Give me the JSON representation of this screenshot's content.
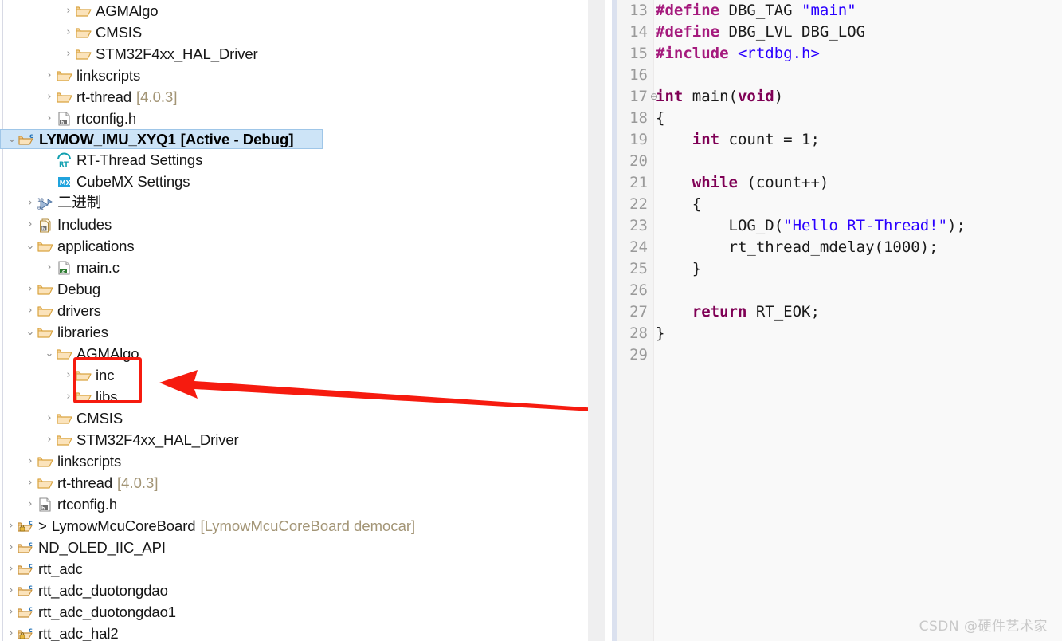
{
  "explorer": {
    "name": "project-explorer",
    "rows": [
      {
        "indent": 3,
        "twisty": "collapsed",
        "icon": "folder-icon",
        "label": "AGMAlgo",
        "suffix": ""
      },
      {
        "indent": 3,
        "twisty": "collapsed",
        "icon": "folder-icon",
        "label": "CMSIS",
        "suffix": ""
      },
      {
        "indent": 3,
        "twisty": "collapsed",
        "icon": "folder-icon",
        "label": "STM32F4xx_HAL_Driver",
        "suffix": ""
      },
      {
        "indent": 2,
        "twisty": "collapsed",
        "icon": "folder-icon",
        "label": "linkscripts",
        "suffix": ""
      },
      {
        "indent": 2,
        "twisty": "collapsed",
        "icon": "folder-icon",
        "label": "rt-thread",
        "suffix": "[4.0.3]"
      },
      {
        "indent": 2,
        "twisty": "collapsed",
        "icon": "header-file-icon",
        "label": "rtconfig.h",
        "suffix": ""
      },
      {
        "indent": 0,
        "twisty": "expanded",
        "icon": "c-project-icon",
        "label": "LYMOW_IMU_XYQ1",
        "suffix": "[Active - Debug]",
        "selected": true
      },
      {
        "indent": 2,
        "twisty": "none",
        "icon": "rt-thread-settings-icon",
        "label": "RT-Thread Settings",
        "suffix": ""
      },
      {
        "indent": 2,
        "twisty": "none",
        "icon": "cubemx-settings-icon",
        "label": "CubeMX Settings",
        "suffix": ""
      },
      {
        "indent": 1,
        "twisty": "collapsed",
        "icon": "binaries-icon",
        "label": "二进制",
        "suffix": "",
        "cjk": true
      },
      {
        "indent": 1,
        "twisty": "collapsed",
        "icon": "includes-icon",
        "label": "Includes",
        "suffix": ""
      },
      {
        "indent": 1,
        "twisty": "expanded",
        "icon": "folder-icon",
        "label": "applications",
        "suffix": ""
      },
      {
        "indent": 2,
        "twisty": "collapsed",
        "icon": "c-file-icon",
        "label": "main.c",
        "suffix": ""
      },
      {
        "indent": 1,
        "twisty": "collapsed",
        "icon": "folder-icon",
        "label": "Debug",
        "suffix": ""
      },
      {
        "indent": 1,
        "twisty": "collapsed",
        "icon": "folder-icon",
        "label": "drivers",
        "suffix": ""
      },
      {
        "indent": 1,
        "twisty": "expanded",
        "icon": "folder-icon",
        "label": "libraries",
        "suffix": ""
      },
      {
        "indent": 2,
        "twisty": "expanded",
        "icon": "folder-icon",
        "label": "AGMAlgo",
        "suffix": ""
      },
      {
        "indent": 3,
        "twisty": "collapsed",
        "icon": "folder-icon",
        "label": "inc",
        "suffix": "",
        "highlighted": true
      },
      {
        "indent": 3,
        "twisty": "collapsed",
        "icon": "folder-icon",
        "label": "libs",
        "suffix": "",
        "highlighted": true
      },
      {
        "indent": 2,
        "twisty": "collapsed",
        "icon": "folder-icon",
        "label": "CMSIS",
        "suffix": ""
      },
      {
        "indent": 2,
        "twisty": "collapsed",
        "icon": "folder-icon",
        "label": "STM32F4xx_HAL_Driver",
        "suffix": ""
      },
      {
        "indent": 1,
        "twisty": "collapsed",
        "icon": "folder-icon",
        "label": "linkscripts",
        "suffix": ""
      },
      {
        "indent": 1,
        "twisty": "collapsed",
        "icon": "folder-icon",
        "label": "rt-thread",
        "suffix": "[4.0.3]"
      },
      {
        "indent": 1,
        "twisty": "collapsed",
        "icon": "header-file-icon",
        "label": "rtconfig.h",
        "suffix": ""
      },
      {
        "indent": 0,
        "twisty": "collapsed",
        "icon": "c-project-locked-icon",
        "prefix": ">",
        "label": "LymowMcuCoreBoard",
        "suffix": "[LymowMcuCoreBoard democar]"
      },
      {
        "indent": 0,
        "twisty": "collapsed",
        "icon": "c-project-icon",
        "label": "ND_OLED_IIC_API",
        "suffix": ""
      },
      {
        "indent": 0,
        "twisty": "collapsed",
        "icon": "c-project-icon",
        "label": "rtt_adc",
        "suffix": ""
      },
      {
        "indent": 0,
        "twisty": "collapsed",
        "icon": "c-project-icon",
        "label": "rtt_adc_duotongdao",
        "suffix": ""
      },
      {
        "indent": 0,
        "twisty": "collapsed",
        "icon": "c-project-icon",
        "label": "rtt_adc_duotongdao1",
        "suffix": ""
      },
      {
        "indent": 0,
        "twisty": "collapsed",
        "icon": "c-project-locked-icon",
        "label": "rtt_adc_hal2",
        "suffix": ""
      }
    ]
  },
  "annotation": {
    "box_color": "#f61b0f",
    "arrow_color": "#f61b0f",
    "box_target": "inc / libs"
  },
  "editor": {
    "name": "code-editor",
    "file": "main.c",
    "first_line": 13,
    "lines": [
      {
        "n": 13,
        "fold": "",
        "tokens": [
          {
            "t": "#define ",
            "c": "pre"
          },
          {
            "t": "DBG_TAG ",
            "c": "pl"
          },
          {
            "t": "\"main\"",
            "c": "str"
          }
        ]
      },
      {
        "n": 14,
        "fold": "",
        "tokens": [
          {
            "t": "#define ",
            "c": "pre"
          },
          {
            "t": "DBG_LVL DBG_LOG",
            "c": "pl"
          }
        ]
      },
      {
        "n": 15,
        "fold": "",
        "tokens": [
          {
            "t": "#include ",
            "c": "pre"
          },
          {
            "t": "<rtdbg.h>",
            "c": "inc"
          }
        ]
      },
      {
        "n": 16,
        "fold": "",
        "tokens": []
      },
      {
        "n": 17,
        "fold": "-",
        "tokens": [
          {
            "t": "int ",
            "c": "kw"
          },
          {
            "t": "main(",
            "c": "pl"
          },
          {
            "t": "void",
            "c": "kw"
          },
          {
            "t": ")",
            "c": "pl"
          }
        ]
      },
      {
        "n": 18,
        "fold": "",
        "tokens": [
          {
            "t": "{",
            "c": "pl"
          }
        ]
      },
      {
        "n": 19,
        "fold": "",
        "tokens": [
          {
            "t": "    ",
            "c": "pl"
          },
          {
            "t": "int ",
            "c": "kw"
          },
          {
            "t": "count = 1;",
            "c": "pl"
          }
        ]
      },
      {
        "n": 20,
        "fold": "",
        "tokens": []
      },
      {
        "n": 21,
        "fold": "",
        "tokens": [
          {
            "t": "    ",
            "c": "pl"
          },
          {
            "t": "while ",
            "c": "kw"
          },
          {
            "t": "(count++)",
            "c": "pl"
          }
        ]
      },
      {
        "n": 22,
        "fold": "",
        "tokens": [
          {
            "t": "    {",
            "c": "pl"
          }
        ]
      },
      {
        "n": 23,
        "fold": "",
        "tokens": [
          {
            "t": "        LOG_D(",
            "c": "pl"
          },
          {
            "t": "\"Hello RT-Thread!\"",
            "c": "str"
          },
          {
            "t": ");",
            "c": "pl"
          }
        ]
      },
      {
        "n": 24,
        "fold": "",
        "tokens": [
          {
            "t": "        rt_thread_mdelay(1000);",
            "c": "pl"
          }
        ]
      },
      {
        "n": 25,
        "fold": "",
        "tokens": [
          {
            "t": "    }",
            "c": "pl"
          }
        ]
      },
      {
        "n": 26,
        "fold": "",
        "tokens": []
      },
      {
        "n": 27,
        "fold": "",
        "tokens": [
          {
            "t": "    ",
            "c": "pl"
          },
          {
            "t": "return ",
            "c": "kw"
          },
          {
            "t": "RT_EOK;",
            "c": "pl"
          }
        ]
      },
      {
        "n": 28,
        "fold": "",
        "tokens": [
          {
            "t": "}",
            "c": "pl"
          }
        ]
      },
      {
        "n": 29,
        "fold": "",
        "tokens": []
      }
    ]
  },
  "watermark": {
    "text": "CSDN @硬件艺术家"
  },
  "colors": {
    "selection": "#cde4f7",
    "preprocessor": "#a51a7d",
    "keyword": "#7f0055",
    "string": "#2a00ff",
    "line_number": "#9a9a9a",
    "annotation_red": "#f61b0f"
  }
}
